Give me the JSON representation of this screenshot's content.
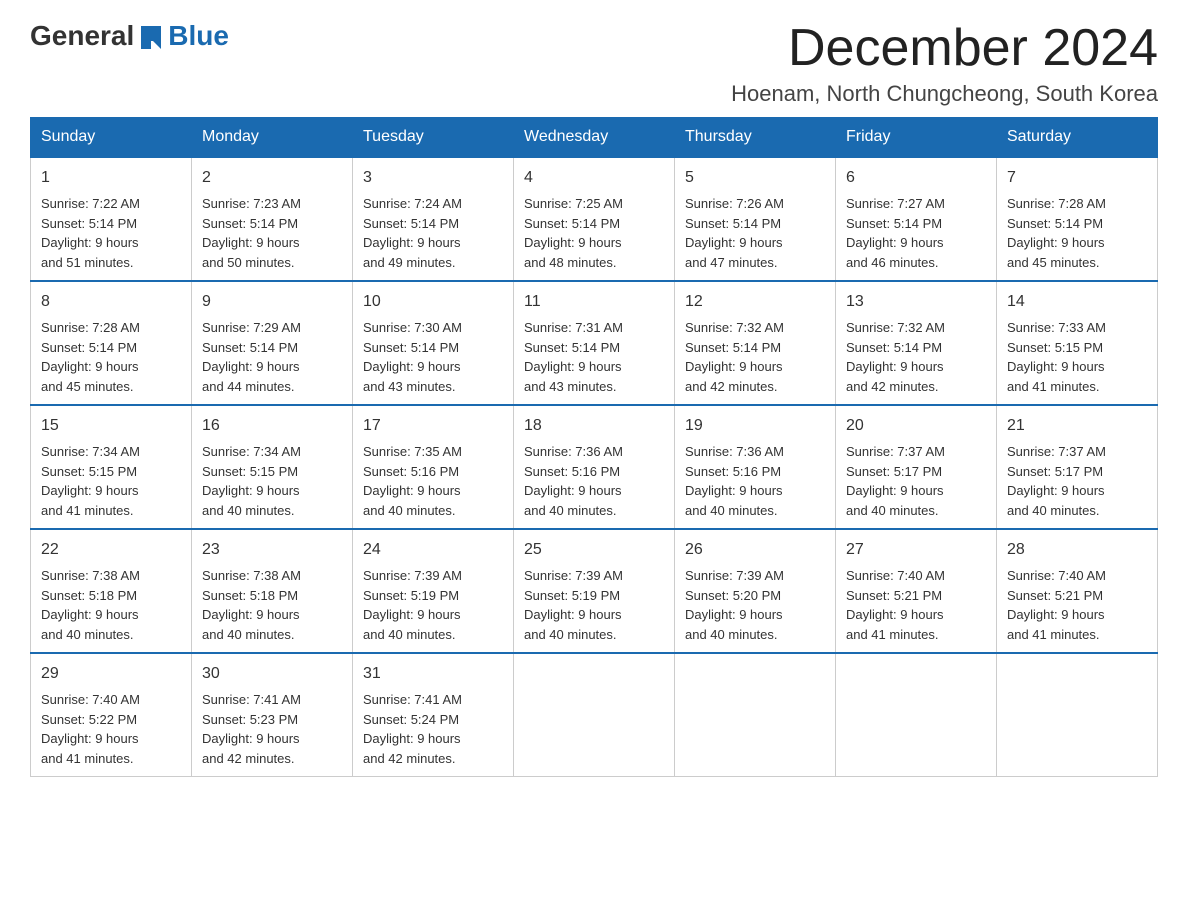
{
  "header": {
    "logo_general": "General",
    "logo_blue": "Blue",
    "month_title": "December 2024",
    "location": "Hoenam, North Chungcheong, South Korea"
  },
  "weekdays": [
    "Sunday",
    "Monday",
    "Tuesday",
    "Wednesday",
    "Thursday",
    "Friday",
    "Saturday"
  ],
  "weeks": [
    [
      {
        "day": "1",
        "lines": [
          "Sunrise: 7:22 AM",
          "Sunset: 5:14 PM",
          "Daylight: 9 hours",
          "and 51 minutes."
        ]
      },
      {
        "day": "2",
        "lines": [
          "Sunrise: 7:23 AM",
          "Sunset: 5:14 PM",
          "Daylight: 9 hours",
          "and 50 minutes."
        ]
      },
      {
        "day": "3",
        "lines": [
          "Sunrise: 7:24 AM",
          "Sunset: 5:14 PM",
          "Daylight: 9 hours",
          "and 49 minutes."
        ]
      },
      {
        "day": "4",
        "lines": [
          "Sunrise: 7:25 AM",
          "Sunset: 5:14 PM",
          "Daylight: 9 hours",
          "and 48 minutes."
        ]
      },
      {
        "day": "5",
        "lines": [
          "Sunrise: 7:26 AM",
          "Sunset: 5:14 PM",
          "Daylight: 9 hours",
          "and 47 minutes."
        ]
      },
      {
        "day": "6",
        "lines": [
          "Sunrise: 7:27 AM",
          "Sunset: 5:14 PM",
          "Daylight: 9 hours",
          "and 46 minutes."
        ]
      },
      {
        "day": "7",
        "lines": [
          "Sunrise: 7:28 AM",
          "Sunset: 5:14 PM",
          "Daylight: 9 hours",
          "and 45 minutes."
        ]
      }
    ],
    [
      {
        "day": "8",
        "lines": [
          "Sunrise: 7:28 AM",
          "Sunset: 5:14 PM",
          "Daylight: 9 hours",
          "and 45 minutes."
        ]
      },
      {
        "day": "9",
        "lines": [
          "Sunrise: 7:29 AM",
          "Sunset: 5:14 PM",
          "Daylight: 9 hours",
          "and 44 minutes."
        ]
      },
      {
        "day": "10",
        "lines": [
          "Sunrise: 7:30 AM",
          "Sunset: 5:14 PM",
          "Daylight: 9 hours",
          "and 43 minutes."
        ]
      },
      {
        "day": "11",
        "lines": [
          "Sunrise: 7:31 AM",
          "Sunset: 5:14 PM",
          "Daylight: 9 hours",
          "and 43 minutes."
        ]
      },
      {
        "day": "12",
        "lines": [
          "Sunrise: 7:32 AM",
          "Sunset: 5:14 PM",
          "Daylight: 9 hours",
          "and 42 minutes."
        ]
      },
      {
        "day": "13",
        "lines": [
          "Sunrise: 7:32 AM",
          "Sunset: 5:14 PM",
          "Daylight: 9 hours",
          "and 42 minutes."
        ]
      },
      {
        "day": "14",
        "lines": [
          "Sunrise: 7:33 AM",
          "Sunset: 5:15 PM",
          "Daylight: 9 hours",
          "and 41 minutes."
        ]
      }
    ],
    [
      {
        "day": "15",
        "lines": [
          "Sunrise: 7:34 AM",
          "Sunset: 5:15 PM",
          "Daylight: 9 hours",
          "and 41 minutes."
        ]
      },
      {
        "day": "16",
        "lines": [
          "Sunrise: 7:34 AM",
          "Sunset: 5:15 PM",
          "Daylight: 9 hours",
          "and 40 minutes."
        ]
      },
      {
        "day": "17",
        "lines": [
          "Sunrise: 7:35 AM",
          "Sunset: 5:16 PM",
          "Daylight: 9 hours",
          "and 40 minutes."
        ]
      },
      {
        "day": "18",
        "lines": [
          "Sunrise: 7:36 AM",
          "Sunset: 5:16 PM",
          "Daylight: 9 hours",
          "and 40 minutes."
        ]
      },
      {
        "day": "19",
        "lines": [
          "Sunrise: 7:36 AM",
          "Sunset: 5:16 PM",
          "Daylight: 9 hours",
          "and 40 minutes."
        ]
      },
      {
        "day": "20",
        "lines": [
          "Sunrise: 7:37 AM",
          "Sunset: 5:17 PM",
          "Daylight: 9 hours",
          "and 40 minutes."
        ]
      },
      {
        "day": "21",
        "lines": [
          "Sunrise: 7:37 AM",
          "Sunset: 5:17 PM",
          "Daylight: 9 hours",
          "and 40 minutes."
        ]
      }
    ],
    [
      {
        "day": "22",
        "lines": [
          "Sunrise: 7:38 AM",
          "Sunset: 5:18 PM",
          "Daylight: 9 hours",
          "and 40 minutes."
        ]
      },
      {
        "day": "23",
        "lines": [
          "Sunrise: 7:38 AM",
          "Sunset: 5:18 PM",
          "Daylight: 9 hours",
          "and 40 minutes."
        ]
      },
      {
        "day": "24",
        "lines": [
          "Sunrise: 7:39 AM",
          "Sunset: 5:19 PM",
          "Daylight: 9 hours",
          "and 40 minutes."
        ]
      },
      {
        "day": "25",
        "lines": [
          "Sunrise: 7:39 AM",
          "Sunset: 5:19 PM",
          "Daylight: 9 hours",
          "and 40 minutes."
        ]
      },
      {
        "day": "26",
        "lines": [
          "Sunrise: 7:39 AM",
          "Sunset: 5:20 PM",
          "Daylight: 9 hours",
          "and 40 minutes."
        ]
      },
      {
        "day": "27",
        "lines": [
          "Sunrise: 7:40 AM",
          "Sunset: 5:21 PM",
          "Daylight: 9 hours",
          "and 41 minutes."
        ]
      },
      {
        "day": "28",
        "lines": [
          "Sunrise: 7:40 AM",
          "Sunset: 5:21 PM",
          "Daylight: 9 hours",
          "and 41 minutes."
        ]
      }
    ],
    [
      {
        "day": "29",
        "lines": [
          "Sunrise: 7:40 AM",
          "Sunset: 5:22 PM",
          "Daylight: 9 hours",
          "and 41 minutes."
        ]
      },
      {
        "day": "30",
        "lines": [
          "Sunrise: 7:41 AM",
          "Sunset: 5:23 PM",
          "Daylight: 9 hours",
          "and 42 minutes."
        ]
      },
      {
        "day": "31",
        "lines": [
          "Sunrise: 7:41 AM",
          "Sunset: 5:24 PM",
          "Daylight: 9 hours",
          "and 42 minutes."
        ]
      },
      null,
      null,
      null,
      null
    ]
  ]
}
